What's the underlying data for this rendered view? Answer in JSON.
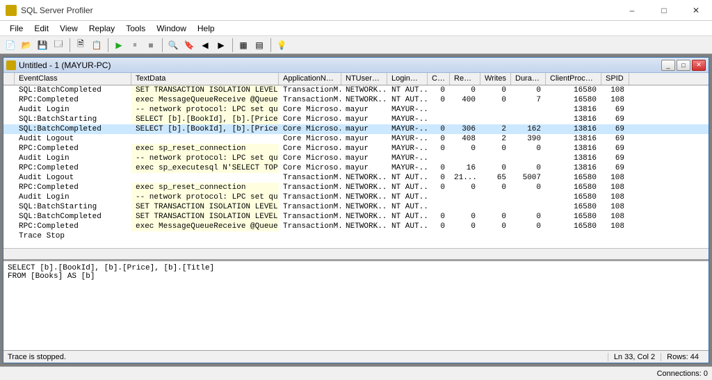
{
  "app": {
    "title": "SQL Server Profiler"
  },
  "menus": [
    "File",
    "Edit",
    "View",
    "Replay",
    "Tools",
    "Window",
    "Help"
  ],
  "toolbar_icons": [
    "new-trace",
    "open-file",
    "save",
    "props",
    "copy",
    "template",
    "run",
    "pause",
    "stop",
    "sep",
    "find",
    "bookmark",
    "prev",
    "next",
    "sep2",
    "grid",
    "grid2",
    "autoscroll"
  ],
  "child": {
    "title": "Untitled - 1 (MAYUR-PC)"
  },
  "columns": [
    {
      "key": "event",
      "label": "EventClass",
      "cls": "c-event"
    },
    {
      "key": "text",
      "label": "TextData",
      "cls": "c-text"
    },
    {
      "key": "app",
      "label": "ApplicationName",
      "cls": "c-app"
    },
    {
      "key": "nt",
      "label": "NTUserName",
      "cls": "c-nt"
    },
    {
      "key": "login",
      "label": "LoginName",
      "cls": "c-login"
    },
    {
      "key": "cpu",
      "label": "CPU",
      "cls": "c-cpu",
      "num": true
    },
    {
      "key": "reads",
      "label": "Reads",
      "cls": "c-reads",
      "num": true
    },
    {
      "key": "writes",
      "label": "Writes",
      "cls": "c-writes",
      "num": true
    },
    {
      "key": "dur",
      "label": "Duration",
      "cls": "c-dur",
      "num": true
    },
    {
      "key": "cpid",
      "label": "ClientProcessID",
      "cls": "c-cpid",
      "num": true
    },
    {
      "key": "spid",
      "label": "SPID",
      "cls": "c-spid",
      "num": true
    }
  ],
  "rows": [
    {
      "event": "SQL:BatchCompleted",
      "text": "SET TRANSACTION ISOLATION LEVEL READ...",
      "app": "TransactionM...",
      "nt": "NETWORK...",
      "login": "NT AUT...",
      "cpu": "0",
      "reads": "0",
      "writes": "0",
      "dur": "0",
      "cpid": "16580",
      "spid": "108"
    },
    {
      "event": "RPC:Completed",
      "text": "exec MessageQueueReceive @QueueName=...",
      "app": "TransactionM...",
      "nt": "NETWORK...",
      "login": "NT AUT...",
      "cpu": "0",
      "reads": "400",
      "writes": "0",
      "dur": "7",
      "cpid": "16580",
      "spid": "108"
    },
    {
      "event": "Audit Login",
      "text": "-- network protocol: LPC  set quoted...",
      "app": "Core Microso...",
      "nt": "mayur",
      "login": "MAYUR-...",
      "cpu": "",
      "reads": "",
      "writes": "",
      "dur": "",
      "cpid": "13816",
      "spid": "69"
    },
    {
      "event": "SQL:BatchStarting",
      "text": "SELECT [b].[BookId], [b].[Price], [b...",
      "app": "Core Microso...",
      "nt": "mayur",
      "login": "MAYUR-...",
      "cpu": "",
      "reads": "",
      "writes": "",
      "dur": "",
      "cpid": "13816",
      "spid": "69"
    },
    {
      "event": "SQL:BatchCompleted",
      "text": "SELECT [b].[BookId], [b].[Price], [b...",
      "app": "Core Microso...",
      "nt": "mayur",
      "login": "MAYUR-...",
      "cpu": "0",
      "reads": "306",
      "writes": "2",
      "dur": "162",
      "cpid": "13816",
      "spid": "69",
      "selected": true
    },
    {
      "event": "Audit Logout",
      "text": "",
      "app": "Core Microso...",
      "nt": "mayur",
      "login": "MAYUR-...",
      "cpu": "0",
      "reads": "408",
      "writes": "2",
      "dur": "390",
      "cpid": "13816",
      "spid": "69"
    },
    {
      "event": "RPC:Completed",
      "text": "exec sp_reset_connection",
      "app": "Core Microso...",
      "nt": "mayur",
      "login": "MAYUR-...",
      "cpu": "0",
      "reads": "0",
      "writes": "0",
      "dur": "0",
      "cpid": "13816",
      "spid": "69"
    },
    {
      "event": "Audit Login",
      "text": "-- network protocol: LPC  set quoted...",
      "app": "Core Microso...",
      "nt": "mayur",
      "login": "MAYUR-...",
      "cpu": "",
      "reads": "",
      "writes": "",
      "dur": "",
      "cpid": "13816",
      "spid": "69"
    },
    {
      "event": "RPC:Completed",
      "text": "exec sp_executesql N'SELECT TOP(@__p...",
      "app": "Core Microso...",
      "nt": "mayur",
      "login": "MAYUR-...",
      "cpu": "0",
      "reads": "16",
      "writes": "0",
      "dur": "0",
      "cpid": "13816",
      "spid": "69"
    },
    {
      "event": "Audit Logout",
      "text": "",
      "app": "TransactionM...",
      "nt": "NETWORK...",
      "login": "NT AUT...",
      "cpu": "0",
      "reads": "21...",
      "writes": "65",
      "dur": "5007",
      "cpid": "16580",
      "spid": "108"
    },
    {
      "event": "RPC:Completed",
      "text": "exec sp_reset_connection",
      "app": "TransactionM...",
      "nt": "NETWORK...",
      "login": "NT AUT...",
      "cpu": "0",
      "reads": "0",
      "writes": "0",
      "dur": "0",
      "cpid": "16580",
      "spid": "108"
    },
    {
      "event": "Audit Login",
      "text": "-- network protocol: LPC  set quoted...",
      "app": "TransactionM...",
      "nt": "NETWORK...",
      "login": "NT AUT...",
      "cpu": "",
      "reads": "",
      "writes": "",
      "dur": "",
      "cpid": "16580",
      "spid": "108"
    },
    {
      "event": "SQL:BatchStarting",
      "text": "SET TRANSACTION ISOLATION LEVEL READ...",
      "app": "TransactionM...",
      "nt": "NETWORK...",
      "login": "NT AUT...",
      "cpu": "",
      "reads": "",
      "writes": "",
      "dur": "",
      "cpid": "16580",
      "spid": "108"
    },
    {
      "event": "SQL:BatchCompleted",
      "text": "SET TRANSACTION ISOLATION LEVEL READ...",
      "app": "TransactionM...",
      "nt": "NETWORK...",
      "login": "NT AUT...",
      "cpu": "0",
      "reads": "0",
      "writes": "0",
      "dur": "0",
      "cpid": "16580",
      "spid": "108"
    },
    {
      "event": "RPC:Completed",
      "text": "exec MessageQueueReceive @QueueName=...",
      "app": "TransactionM...",
      "nt": "NETWORK...",
      "login": "NT AUT...",
      "cpu": "0",
      "reads": "0",
      "writes": "0",
      "dur": "0",
      "cpid": "16580",
      "spid": "108"
    },
    {
      "event": "Trace Stop",
      "text": "",
      "app": "",
      "nt": "",
      "login": "",
      "cpu": "",
      "reads": "",
      "writes": "",
      "dur": "",
      "cpid": "",
      "spid": ""
    }
  ],
  "detail_text": "SELECT [b].[BookId], [b].[Price], [b].[Title]\nFROM [Books] AS [b]",
  "child_status": {
    "left": "Trace is stopped.",
    "ln": "Ln 33, Col 2",
    "rows": "Rows: 44"
  },
  "main_status": {
    "connections": "Connections: 0"
  }
}
